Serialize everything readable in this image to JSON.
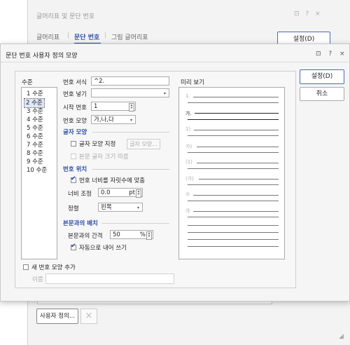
{
  "background_dialog": {
    "title": "글머리표 및 문단 번호",
    "title_icons": "⊡ ? ×",
    "tabs": [
      "글머리표",
      "문단 번호",
      "그림 글머리표"
    ],
    "settings_button": "설정(D)",
    "custom_button": "사용자 정의...",
    "delete_icon": "×"
  },
  "dialog": {
    "title": "문단 번호 사용자 정의 모양",
    "title_icons": "⊡ ? ×",
    "level_label": "수준",
    "levels": [
      "1 수준",
      "2 수준",
      "3 수준",
      "4 수준",
      "5 수준",
      "6 수준",
      "7 수준",
      "8 수준",
      "9 수준",
      "10 수준"
    ],
    "selected_level": "2 수준",
    "number_format": {
      "label": "번호 서식",
      "value": "^2."
    },
    "number_insert": {
      "label": "번호 넣기",
      "value": ""
    },
    "start_number": {
      "label": "시작 번호",
      "value": "1"
    },
    "number_shape": {
      "label": "번호 모양",
      "value": "가,나,다"
    },
    "char_shape_section": "글자 모양",
    "char_shape_specify": {
      "label": "글자 모양 지정",
      "checked": false
    },
    "char_shape_button": "글자 모양...",
    "follow_body_size": {
      "label": "본문 글자 크기 따름",
      "checked": false,
      "disabled": true
    },
    "number_position_section": "번호 위치",
    "fit_width": {
      "label": "번호 너비를 자릿수에 맞춤",
      "checked": true
    },
    "width_adjust": {
      "label": "너비 조정",
      "value": "0.0",
      "unit": "pt"
    },
    "align": {
      "label": "정렬",
      "value": "왼쪽"
    },
    "body_placement_section": "본문과의 배치",
    "body_gap": {
      "label": "본문과의 간격",
      "value": "50",
      "unit": "%"
    },
    "auto_indent": {
      "label": "자동으로 내어 쓰기",
      "checked": true
    },
    "preview_label": "미리 보기",
    "preview_markers": [
      "1.",
      "가.",
      "1)",
      "가)",
      "(1)",
      "(가)",
      "①",
      "㉮"
    ],
    "ok_button": "설정(D)",
    "cancel_button": "취소",
    "add_new_shape": {
      "label": "새 번호 모양 추가",
      "checked": false
    },
    "name_label": "이름",
    "name_value": ""
  }
}
